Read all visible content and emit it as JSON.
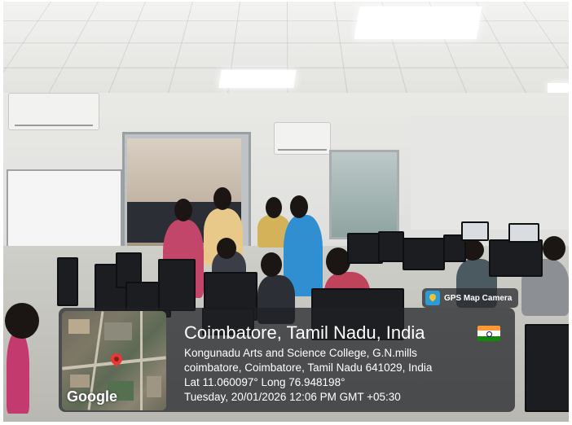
{
  "photo": {
    "description_free": true
  },
  "overlay": {
    "badge_label": "GPS Map Camera",
    "badge_icon": "gps-map-camera-icon",
    "location_title": "Coimbatore, Tamil Nadu, India",
    "flag_icon": "india-flag-icon",
    "address_line_1": "Kongunadu Arts and Science College, G.N.mills",
    "address_line_2": "coimbatore, Coimbatore, Tamil Nadu 641029, India",
    "coordinates": "Lat 11.060097° Long 76.948198°",
    "timestamp": "Tuesday, 20/01/2026 12:06 PM GMT +05:30",
    "map_logo": "Google"
  },
  "colors": {
    "overlay_bg": "#1e2024",
    "text": "#ffffff",
    "pin": "#e53935"
  }
}
